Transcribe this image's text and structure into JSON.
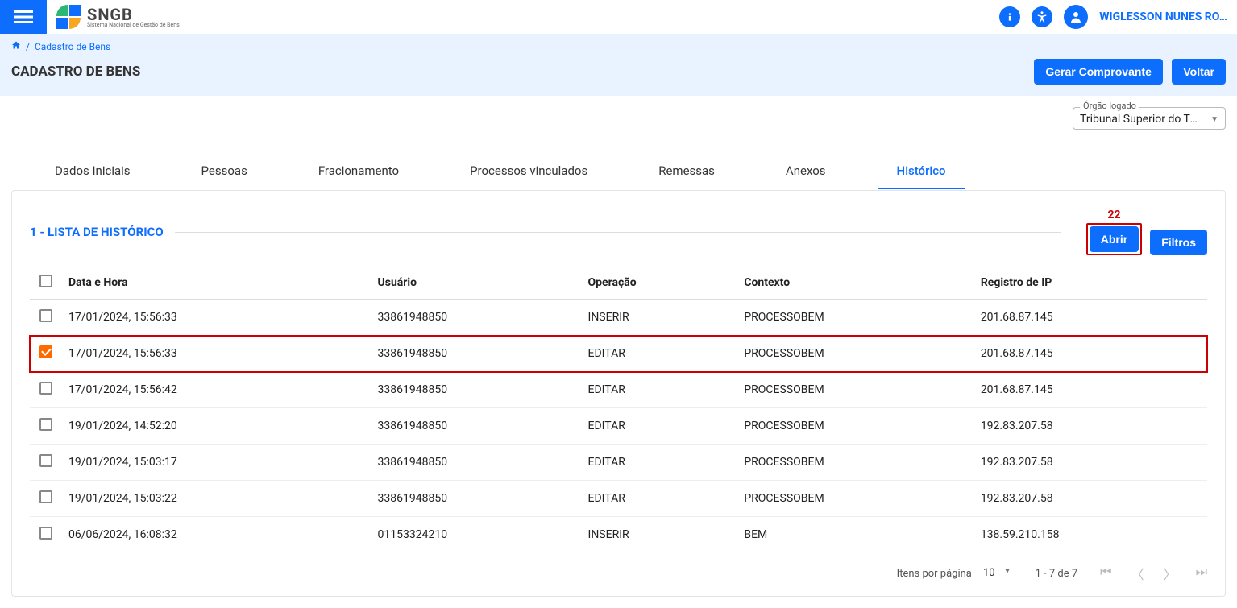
{
  "app": {
    "brand_big": "SNGB",
    "brand_small": "Sistema Nacional de Gestão de Bens"
  },
  "user": {
    "display": "WIGLESSON NUNES RO…"
  },
  "breadcrumb": {
    "current": "Cadastro de Bens"
  },
  "page": {
    "title": "CADASTRO DE BENS",
    "gerar_label": "Gerar Comprovante",
    "voltar_label": "Voltar"
  },
  "orgao": {
    "legend": "Órgão logado",
    "value": "Tribunal Superior do Tra…"
  },
  "tabs": [
    {
      "label": "Dados Iniciais",
      "active": false
    },
    {
      "label": "Pessoas",
      "active": false
    },
    {
      "label": "Fracionamento",
      "active": false
    },
    {
      "label": "Processos vinculados",
      "active": false
    },
    {
      "label": "Remessas",
      "active": false
    },
    {
      "label": "Anexos",
      "active": false
    },
    {
      "label": "Histórico",
      "active": true
    }
  ],
  "panel": {
    "title": "1 - LISTA DE HISTÓRICO",
    "abrir_label": "Abrir",
    "filtros_label": "Filtros",
    "abrir_annotation": "22"
  },
  "columns": {
    "data": "Data e Hora",
    "usuario": "Usuário",
    "operacao": "Operação",
    "contexto": "Contexto",
    "ip": "Registro de IP"
  },
  "rows": [
    {
      "checked": false,
      "highlight": false,
      "data": "17/01/2024, 15:56:33",
      "usuario": "33861948850",
      "operacao": "INSERIR",
      "contexto": "PROCESSOBEM",
      "ip": "201.68.87.145"
    },
    {
      "checked": true,
      "highlight": true,
      "data": "17/01/2024, 15:56:33",
      "usuario": "33861948850",
      "operacao": "EDITAR",
      "contexto": "PROCESSOBEM",
      "ip": "201.68.87.145"
    },
    {
      "checked": false,
      "highlight": false,
      "data": "17/01/2024, 15:56:42",
      "usuario": "33861948850",
      "operacao": "EDITAR",
      "contexto": "PROCESSOBEM",
      "ip": "201.68.87.145"
    },
    {
      "checked": false,
      "highlight": false,
      "data": "19/01/2024, 14:52:20",
      "usuario": "33861948850",
      "operacao": "EDITAR",
      "contexto": "PROCESSOBEM",
      "ip": "192.83.207.58"
    },
    {
      "checked": false,
      "highlight": false,
      "data": "19/01/2024, 15:03:17",
      "usuario": "33861948850",
      "operacao": "EDITAR",
      "contexto": "PROCESSOBEM",
      "ip": "192.83.207.58"
    },
    {
      "checked": false,
      "highlight": false,
      "data": "19/01/2024, 15:03:22",
      "usuario": "33861948850",
      "operacao": "EDITAR",
      "contexto": "PROCESSOBEM",
      "ip": "192.83.207.58"
    },
    {
      "checked": false,
      "highlight": false,
      "data": "06/06/2024, 16:08:32",
      "usuario": "01153324210",
      "operacao": "INSERIR",
      "contexto": "BEM",
      "ip": "138.59.210.158"
    }
  ],
  "pagination": {
    "ipp_label": "Itens por página",
    "ipp_value": "10",
    "range": "1 - 7 de 7"
  }
}
